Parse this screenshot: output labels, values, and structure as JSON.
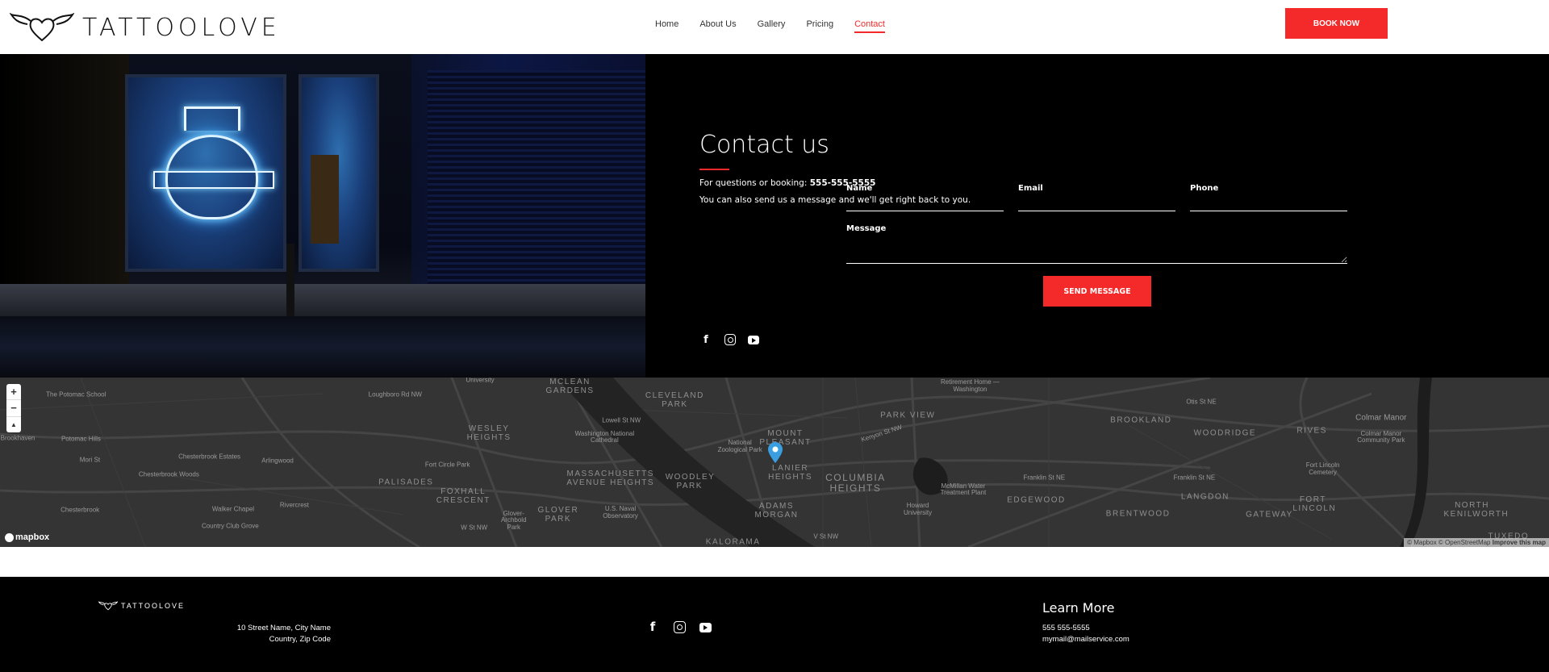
{
  "header": {
    "brand": "TATTOOLOVE",
    "nav": [
      "Home",
      "About Us",
      "Gallery",
      "Pricing",
      "Contact"
    ],
    "active_nav": "Contact",
    "book_now": "BOOK NOW",
    "accent": "#f42a2a"
  },
  "contact": {
    "title": "Contact us",
    "booking_prefix": "For questions or booking: ",
    "phone": "555-555-5555",
    "message_text": "You can also send us a message and we'll get right back to you.",
    "form": {
      "name_label": "Name",
      "email_label": "Email",
      "phone_label": "Phone",
      "message_label": "Message",
      "submit": "SEND MESSAGE"
    },
    "social": [
      "facebook-icon",
      "instagram-icon",
      "youtube-icon"
    ]
  },
  "map": {
    "controls": {
      "zoom_in": "+",
      "zoom_out": "−",
      "compass": "▲"
    },
    "logo": "mapbox",
    "attribution": "© Mapbox © OpenStreetMap",
    "improve": "Improve this map",
    "labels": [
      "The Potomac School",
      "Brookhaven",
      "Potomac Hills",
      "Chesterbrook Estates",
      "Arlingwood",
      "Chesterbrook Woods",
      "Chesterbrook",
      "Walker Chapel",
      "Rivercrest",
      "Country Club Grove",
      "University",
      "MCLEAN GARDENS",
      "CLEVELAND PARK",
      "Loughboro Rd NW",
      "WESLEY HEIGHTS",
      "Washington National Cathedral",
      "Fort Circle Park",
      "PALISADES",
      "MASSACHUSETTS AVENUE HEIGHTS",
      "FOXHALL CRESCENT",
      "GLOVER PARK",
      "U.S. Naval Observatory",
      "National Zoological Park",
      "WOODLEY PARK",
      "MOUNT PLEASANT",
      "LANIER HEIGHTS",
      "COLUMBIA HEIGHTS",
      "ADAMS MORGAN",
      "PARK VIEW",
      "Retirement Home — Washington",
      "McMillan Water Treatment Plant",
      "Howard University",
      "BROOKLAND",
      "WOODRIDGE",
      "RIVES",
      "Colmar Manor",
      "Colmar Manor Community Park",
      "Fort Lincoln Cemetery",
      "Franklin St NE",
      "Franklin St NE",
      "LANGDON",
      "EDGEWOOD",
      "BRENTWOOD",
      "GATEWAY",
      "FORT LINCOLN",
      "NORTH KENILWORTH",
      "KALORAMA",
      "TUXEDO",
      "V St NW",
      "W St NW",
      "Glover-Archbold Park",
      "Kenyon St NW",
      "Otis St NE",
      "Mori St",
      "Lowell St NW"
    ]
  },
  "footer": {
    "brand": "TATTOOLOVE",
    "address_line1": "10 Street Name, City Name",
    "address_line2": "Country, Zip Code",
    "learn_more": "Learn More",
    "phone": "555 555-5555",
    "email": "mymail@mailservice.com"
  }
}
